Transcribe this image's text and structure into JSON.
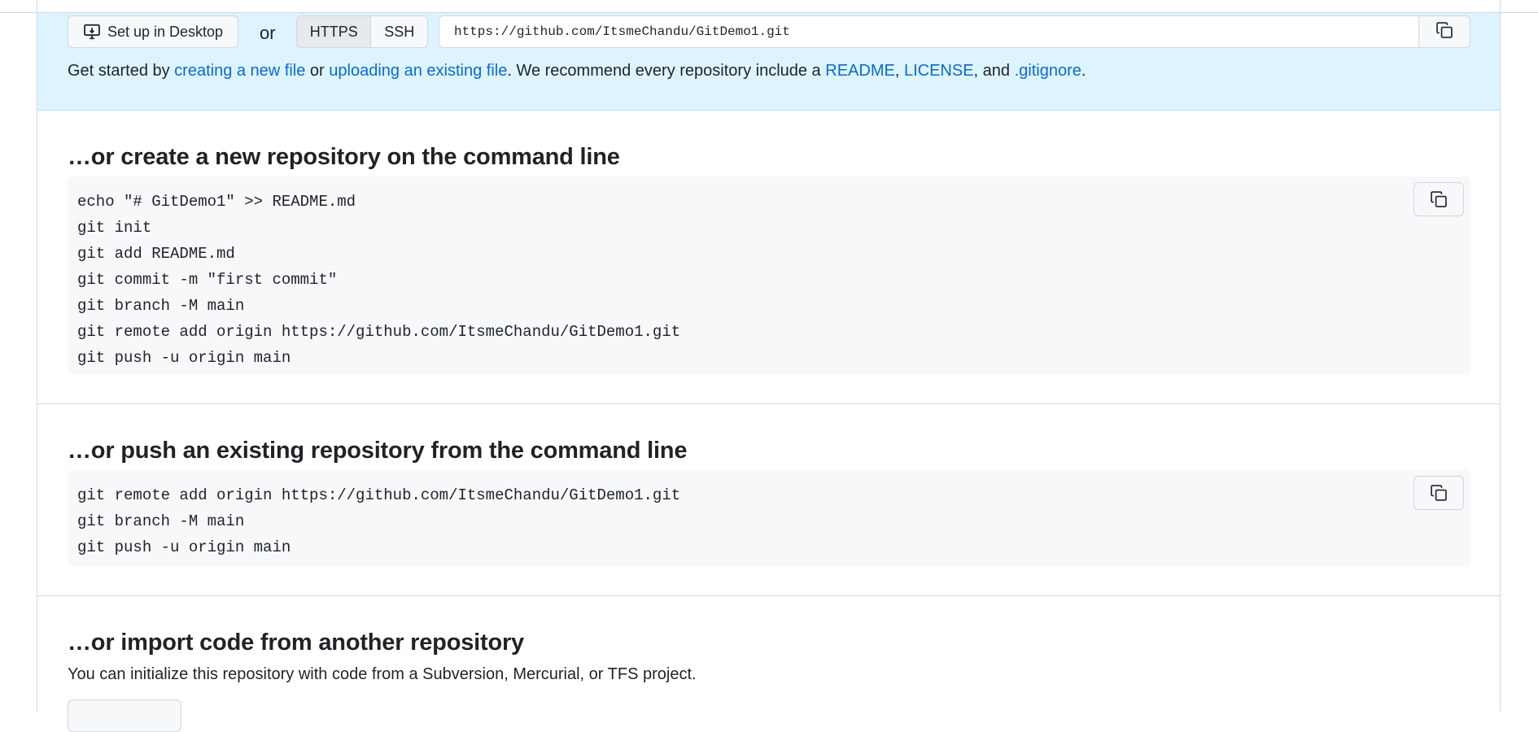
{
  "quick_setup": {
    "desktop_button_label": "Set up in Desktop",
    "or_label": "or",
    "protocols": [
      "HTTPS",
      "SSH"
    ],
    "selected_protocol": "HTTPS",
    "clone_url": "https://github.com/ItsmeChandu/GitDemo1.git",
    "copy_icon": "copy-icon",
    "getstarted": {
      "prefix": "Get started by ",
      "link_new_file": "creating a new file",
      "middle": " or ",
      "link_upload": "uploading an existing file",
      "recommend": ". We recommend every repository include a ",
      "link_readme": "README",
      "comma": ", ",
      "link_license": "LICENSE",
      "and": ", and ",
      "link_gitignore": ".gitignore",
      "end": "."
    }
  },
  "sections": {
    "create_new": {
      "title": "…or create a new repository on the command line",
      "lines": [
        "echo \"# GitDemo1\" >> README.md",
        "git init",
        "git add README.md",
        "git commit -m \"first commit\"",
        "git branch -M main",
        "git remote add origin https://github.com/ItsmeChandu/GitDemo1.git",
        "git push -u origin main"
      ]
    },
    "push_existing": {
      "title": "…or push an existing repository from the command line",
      "lines": [
        "git remote add origin https://github.com/ItsmeChandu/GitDemo1.git",
        "git branch -M main",
        "git push -u origin main"
      ]
    },
    "import_code": {
      "title": "…or import code from another repository",
      "description": "You can initialize this repository with code from a Subversion, Mercurial, or TFS project."
    }
  },
  "colors": {
    "link": "#0969da",
    "quick_setup_bg": "#ddf4ff",
    "code_bg": "#f6f8fa",
    "border": "#d0d7de"
  }
}
